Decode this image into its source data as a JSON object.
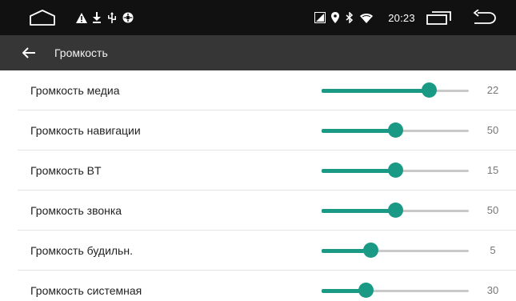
{
  "status_bar": {
    "time": "20:23",
    "left_icons": [
      "home-outline-icon",
      "warning-icon",
      "download-icon",
      "usb-icon",
      "settings-badge-icon"
    ],
    "right_icons": [
      "sim-icon",
      "location-icon",
      "bluetooth-icon",
      "wifi-icon"
    ],
    "nav_icons": [
      "recent-apps-icon",
      "back-nav-icon"
    ]
  },
  "app_bar": {
    "title": "Громкость",
    "back_icon": "arrow-left-icon"
  },
  "colors": {
    "accent": "#1a9985",
    "track": "#c9c9c9",
    "status_bar": "#111111",
    "app_bar": "#363636"
  },
  "volume_items": [
    {
      "label": "Громкость медиа",
      "value": "22",
      "level": 0.73
    },
    {
      "label": "Громкость навигации",
      "value": "50",
      "level": 0.5
    },
    {
      "label": "Громкость BT",
      "value": "15",
      "level": 0.5
    },
    {
      "label": "Громкость звонка",
      "value": "50",
      "level": 0.5
    },
    {
      "label": "Громкость будильн.",
      "value": "5",
      "level": 0.33
    },
    {
      "label": "Громкость системная",
      "value": "30",
      "level": 0.3
    }
  ]
}
